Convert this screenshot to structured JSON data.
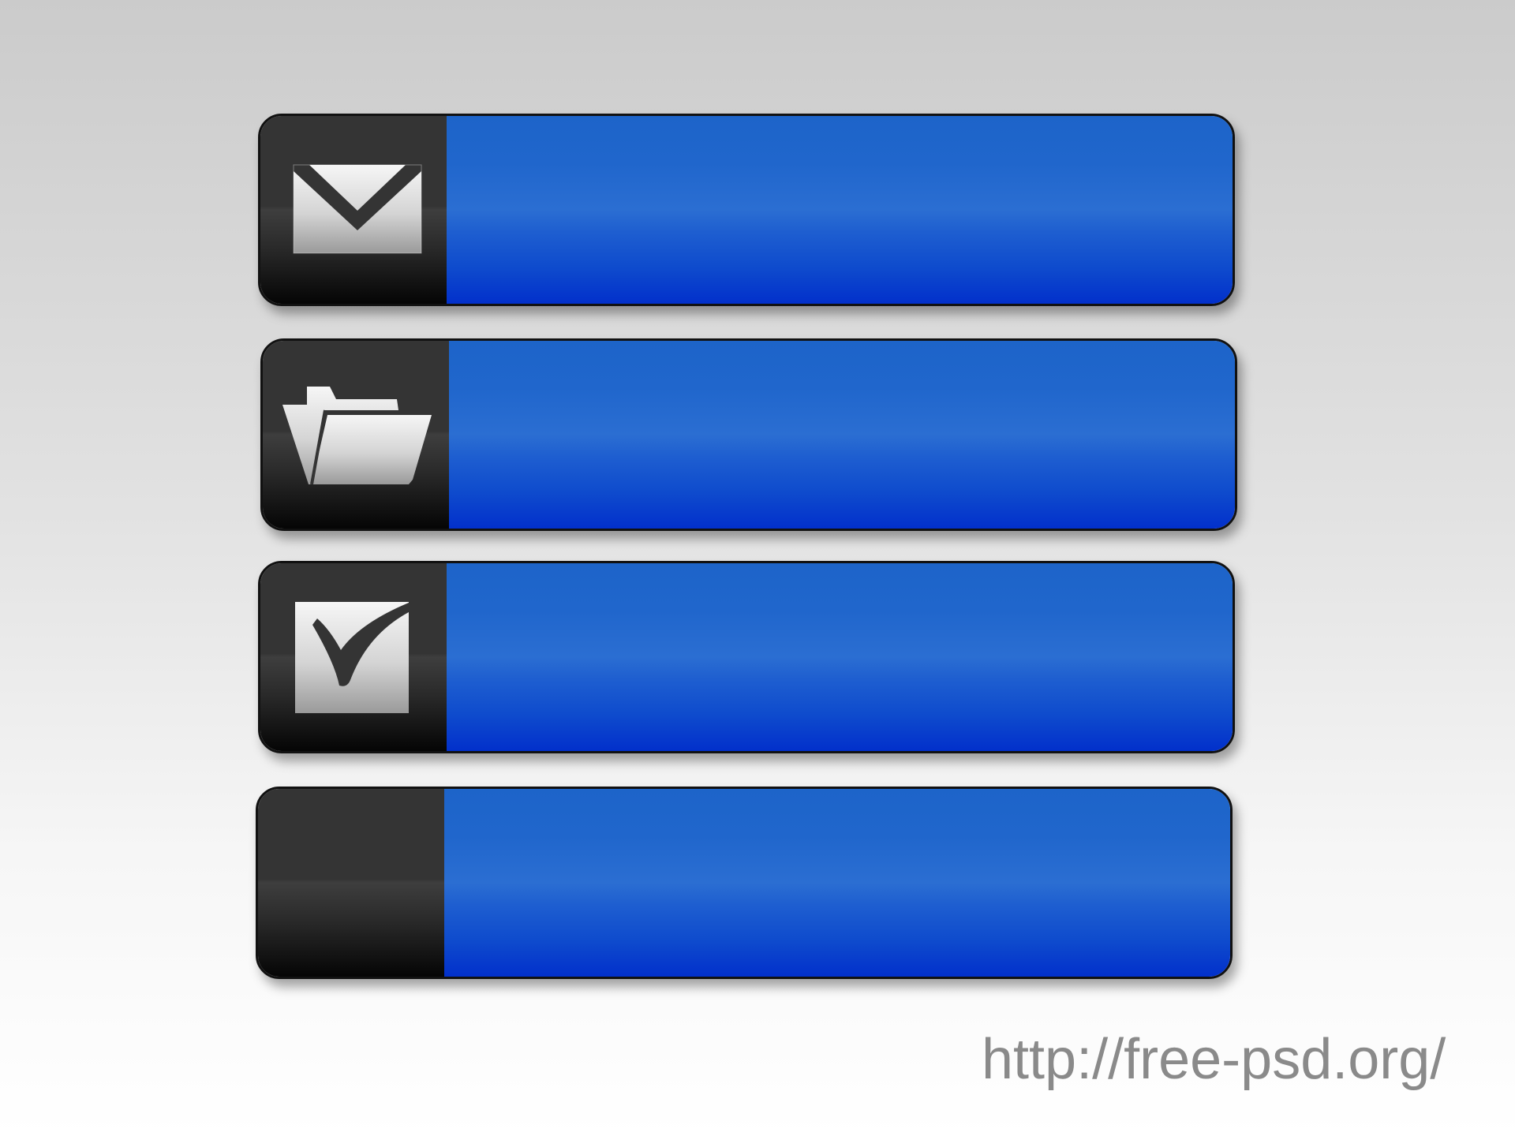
{
  "panels": [
    {
      "icon": "envelope-icon"
    },
    {
      "icon": "folder-open-icon"
    },
    {
      "icon": "checkbox-checked-icon"
    },
    {
      "icon": ""
    }
  ],
  "colors": {
    "background_top": "#cbcbcb",
    "background_bottom": "#ffffff",
    "bar_blue": "#1d64c9",
    "bar_blue_dark": "#0230cb",
    "icon_area_dark": "#343434",
    "icon_fill_light": "#f4f4f4",
    "icon_fill_dark": "#9a9a9a"
  },
  "watermark": {
    "text": "http://free-psd.org/"
  }
}
